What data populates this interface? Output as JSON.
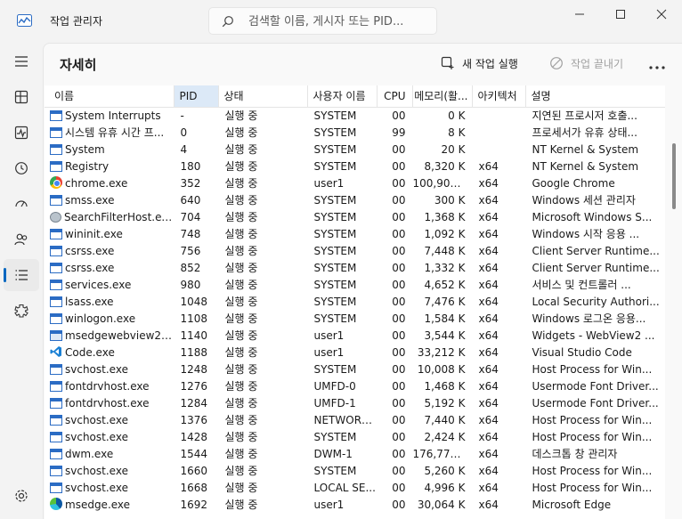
{
  "window": {
    "title": "작업 관리자",
    "search_placeholder": "검색할 이름, 게시자 또는 PID..."
  },
  "nav": {
    "items": [
      {
        "name": "menu-icon",
        "label": "메뉴"
      },
      {
        "name": "processes-icon",
        "label": "프로세스"
      },
      {
        "name": "performance-icon",
        "label": "성능"
      },
      {
        "name": "app-history-icon",
        "label": "앱 기록"
      },
      {
        "name": "startup-apps-icon",
        "label": "시작 앱"
      },
      {
        "name": "users-icon",
        "label": "사용자"
      },
      {
        "name": "details-icon",
        "label": "세부 정보"
      },
      {
        "name": "services-icon",
        "label": "서비스"
      }
    ],
    "active": "details-icon",
    "settings_icon": "settings-icon"
  },
  "page": {
    "title": "자세히",
    "run_new_task": "새 작업 실행",
    "end_task": "작업 끝내기"
  },
  "table": {
    "columns": [
      "이름",
      "PID",
      "상태",
      "사용자 이름",
      "CPU",
      "메모리(활...",
      "아키텍처",
      "설명"
    ],
    "sorted_column": "PID",
    "rows": [
      {
        "icon": "win",
        "name": "System Interrupts",
        "pid": "-",
        "status": "실행 중",
        "user": "SYSTEM",
        "cpu": "00",
        "mem": "0 K",
        "arch": "",
        "desc": "지연된 프로시저 호출..."
      },
      {
        "icon": "win",
        "name": "시스템 유휴 시간 프...",
        "pid": "0",
        "status": "실행 중",
        "user": "SYSTEM",
        "cpu": "99",
        "mem": "8 K",
        "arch": "",
        "desc": "프로세서가 유휴 상태..."
      },
      {
        "icon": "win",
        "name": "System",
        "pid": "4",
        "status": "실행 중",
        "user": "SYSTEM",
        "cpu": "00",
        "mem": "20 K",
        "arch": "",
        "desc": "NT Kernel & System"
      },
      {
        "icon": "win",
        "name": "Registry",
        "pid": "180",
        "status": "실행 중",
        "user": "SYSTEM",
        "cpu": "00",
        "mem": "8,320 K",
        "arch": "x64",
        "desc": "NT Kernel & System"
      },
      {
        "icon": "chrome",
        "name": "chrome.exe",
        "pid": "352",
        "status": "실행 중",
        "user": "user1",
        "cpu": "00",
        "mem": "100,904 K",
        "arch": "x64",
        "desc": "Google Chrome"
      },
      {
        "icon": "win",
        "name": "smss.exe",
        "pid": "640",
        "status": "실행 중",
        "user": "SYSTEM",
        "cpu": "00",
        "mem": "300 K",
        "arch": "x64",
        "desc": "Windows 세션 관리자"
      },
      {
        "icon": "search",
        "name": "SearchFilterHost.exe",
        "pid": "704",
        "status": "실행 중",
        "user": "SYSTEM",
        "cpu": "00",
        "mem": "1,368 K",
        "arch": "x64",
        "desc": "Microsoft Windows S..."
      },
      {
        "icon": "win",
        "name": "wininit.exe",
        "pid": "748",
        "status": "실행 중",
        "user": "SYSTEM",
        "cpu": "00",
        "mem": "1,092 K",
        "arch": "x64",
        "desc": "Windows 시작 응용 ..."
      },
      {
        "icon": "win",
        "name": "csrss.exe",
        "pid": "756",
        "status": "실행 중",
        "user": "SYSTEM",
        "cpu": "00",
        "mem": "7,448 K",
        "arch": "x64",
        "desc": "Client Server Runtime..."
      },
      {
        "icon": "win",
        "name": "csrss.exe",
        "pid": "852",
        "status": "실행 중",
        "user": "SYSTEM",
        "cpu": "00",
        "mem": "1,332 K",
        "arch": "x64",
        "desc": "Client Server Runtime..."
      },
      {
        "icon": "win",
        "name": "services.exe",
        "pid": "980",
        "status": "실행 중",
        "user": "SYSTEM",
        "cpu": "00",
        "mem": "4,652 K",
        "arch": "x64",
        "desc": "서비스 및 컨트롤러 ..."
      },
      {
        "icon": "win",
        "name": "lsass.exe",
        "pid": "1048",
        "status": "실행 중",
        "user": "SYSTEM",
        "cpu": "00",
        "mem": "7,476 K",
        "arch": "x64",
        "desc": "Local Security Authori..."
      },
      {
        "icon": "win",
        "name": "winlogon.exe",
        "pid": "1108",
        "status": "실행 중",
        "user": "SYSTEM",
        "cpu": "00",
        "mem": "1,584 K",
        "arch": "x64",
        "desc": "Windows 로그온 응용..."
      },
      {
        "icon": "edgewv",
        "name": "msedgewebview2.exe",
        "pid": "1140",
        "status": "실행 중",
        "user": "user1",
        "cpu": "00",
        "mem": "3,544 K",
        "arch": "x64",
        "desc": "Widgets - WebView2 ..."
      },
      {
        "icon": "vscode",
        "name": "Code.exe",
        "pid": "1188",
        "status": "실행 중",
        "user": "user1",
        "cpu": "00",
        "mem": "33,212 K",
        "arch": "x64",
        "desc": "Visual Studio Code"
      },
      {
        "icon": "win",
        "name": "svchost.exe",
        "pid": "1248",
        "status": "실행 중",
        "user": "SYSTEM",
        "cpu": "00",
        "mem": "10,008 K",
        "arch": "x64",
        "desc": "Host Process for Win..."
      },
      {
        "icon": "win",
        "name": "fontdrvhost.exe",
        "pid": "1276",
        "status": "실행 중",
        "user": "UMFD-0",
        "cpu": "00",
        "mem": "1,468 K",
        "arch": "x64",
        "desc": "Usermode Font Driver..."
      },
      {
        "icon": "win",
        "name": "fontdrvhost.exe",
        "pid": "1284",
        "status": "실행 중",
        "user": "UMFD-1",
        "cpu": "00",
        "mem": "5,192 K",
        "arch": "x64",
        "desc": "Usermode Font Driver..."
      },
      {
        "icon": "win",
        "name": "svchost.exe",
        "pid": "1376",
        "status": "실행 중",
        "user": "NETWORK...",
        "cpu": "00",
        "mem": "7,440 K",
        "arch": "x64",
        "desc": "Host Process for Win..."
      },
      {
        "icon": "win",
        "name": "svchost.exe",
        "pid": "1428",
        "status": "실행 중",
        "user": "SYSTEM",
        "cpu": "00",
        "mem": "2,424 K",
        "arch": "x64",
        "desc": "Host Process for Win..."
      },
      {
        "icon": "win",
        "name": "dwm.exe",
        "pid": "1544",
        "status": "실행 중",
        "user": "DWM-1",
        "cpu": "00",
        "mem": "176,776 K",
        "arch": "x64",
        "desc": "데스크톱 창 관리자"
      },
      {
        "icon": "win",
        "name": "svchost.exe",
        "pid": "1660",
        "status": "실행 중",
        "user": "SYSTEM",
        "cpu": "00",
        "mem": "5,260 K",
        "arch": "x64",
        "desc": "Host Process for Win..."
      },
      {
        "icon": "win",
        "name": "svchost.exe",
        "pid": "1668",
        "status": "실행 중",
        "user": "LOCAL SE...",
        "cpu": "00",
        "mem": "4,996 K",
        "arch": "x64",
        "desc": "Host Process for Win..."
      },
      {
        "icon": "edge",
        "name": "msedge.exe",
        "pid": "1692",
        "status": "실행 중",
        "user": "user1",
        "cpu": "00",
        "mem": "30,064 K",
        "arch": "x64",
        "desc": "Microsoft Edge"
      }
    ]
  },
  "colors": {
    "accent": "#0067c0",
    "sorted_header": "#dce9f7"
  }
}
